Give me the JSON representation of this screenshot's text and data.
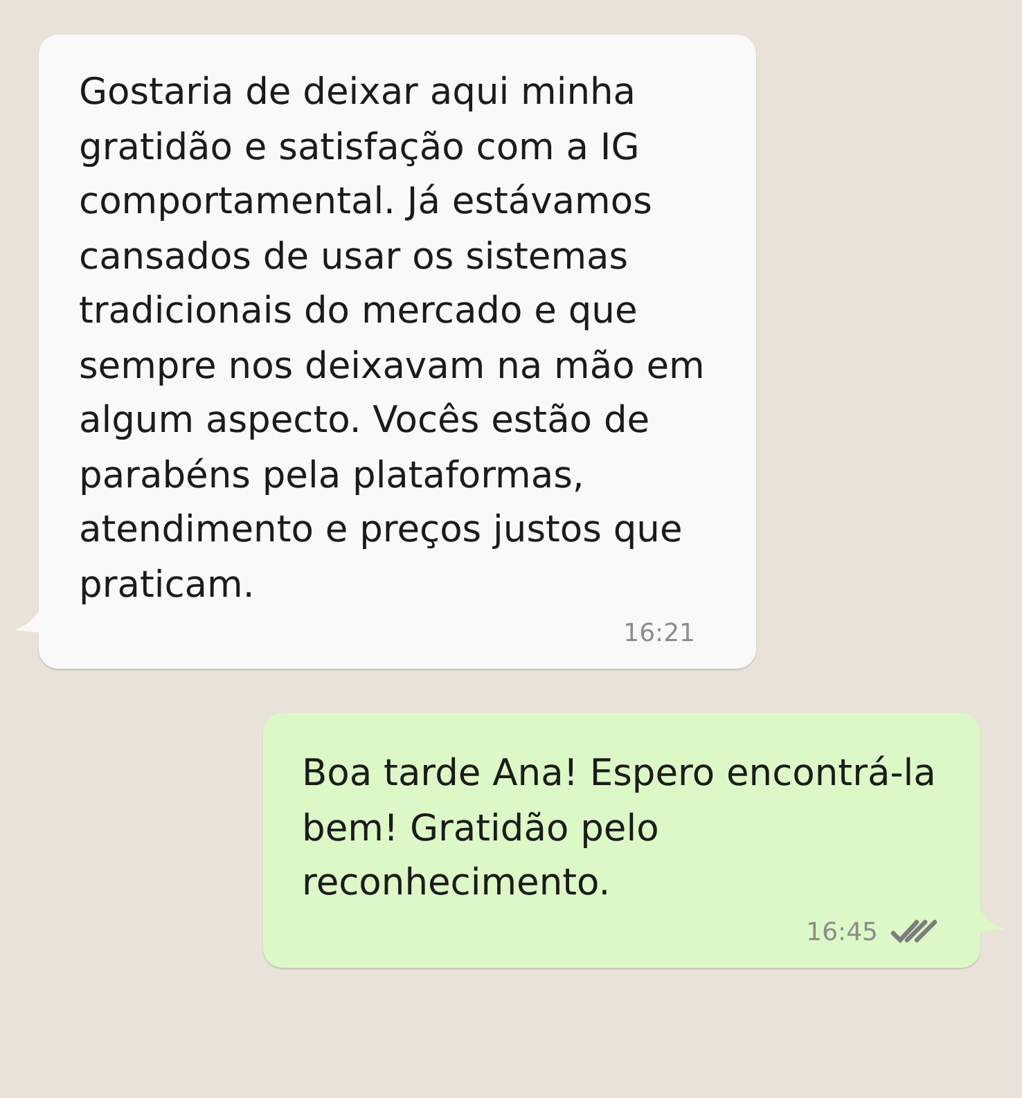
{
  "messages": [
    {
      "kind": "incoming",
      "text": "Gostaria de deixar aqui minha gratidão e satisfação com a IG comportamental. Já estávamos cansados de usar os sistemas tradicionais do mercado e que sempre nos deixavam na mão em algum aspecto. Vocês estão de parabéns pela plataformas, atendimento e preços justos que praticam.",
      "time": "16:21"
    },
    {
      "kind": "outgoing",
      "text": "Boa tarde Ana! Espero encontrá-la bem! Gratidão pelo reconhecimento.",
      "time": "16:45",
      "read": false
    }
  ]
}
